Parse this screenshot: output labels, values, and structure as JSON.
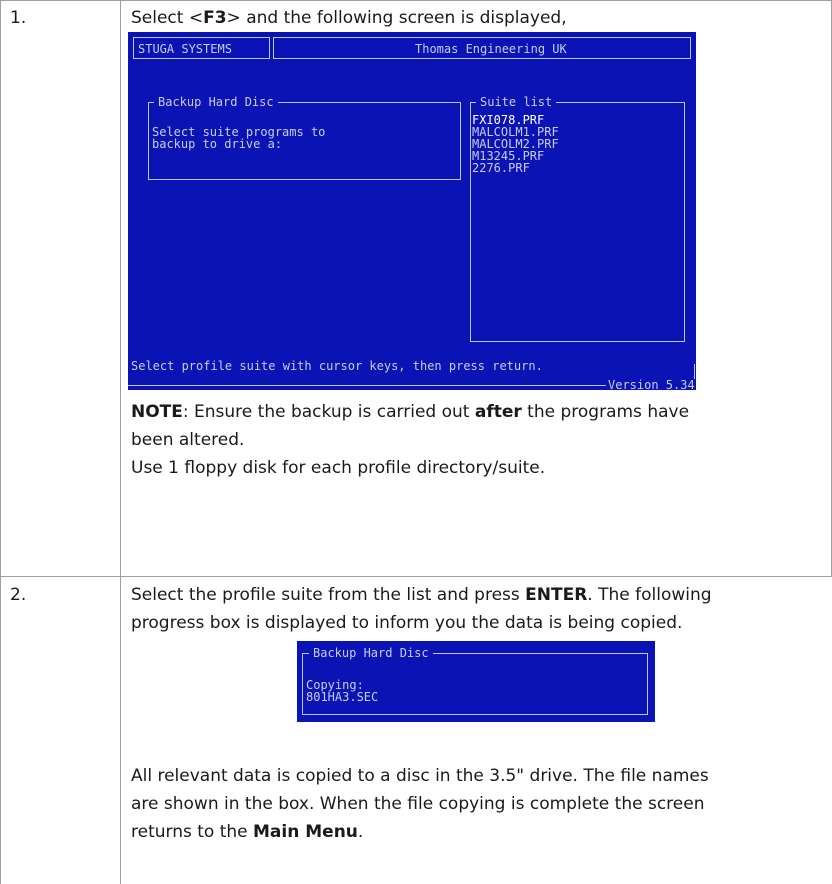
{
  "rows": [
    {
      "number": "1.",
      "intro_prefix": "Select <",
      "intro_key": "F3",
      "intro_suffix": "> and the following screen is displayed,",
      "screen": {
        "company_left": "STUGA SYSTEMS",
        "company_right": "Thomas Engineering UK",
        "panel_title": "Backup Hard Disc",
        "panel_text_1": "Select suite programs to",
        "panel_text_2": "backup to drive a:",
        "list_title": "Suite list",
        "suites": [
          "FXI078.PRF",
          "MALCOLM1.PRF",
          "MALCOLM2.PRF",
          "M13245.PRF",
          "2276.PRF"
        ],
        "status": "Select profile suite with cursor keys, then press return.",
        "version": "Version 5.34"
      },
      "note_label": "NOTE",
      "note_text_1": ": Ensure the backup is carried out ",
      "note_bold": "after",
      "note_text_2": " the programs have",
      "note_text_3": "been altered.",
      "note_line_2": "Use 1 floppy disk for each profile directory/suite."
    },
    {
      "number": "2.",
      "intro_1a": "Select the profile suite from the list and press ",
      "intro_key": "ENTER",
      "intro_1b": ". The following",
      "intro_2": "progress box is displayed to inform you the data is being copied.",
      "box": {
        "title": "Backup Hard Disc",
        "line_1": "Copying:",
        "line_2": "801HA3.SEC"
      },
      "after_1": "All relevant data is copied to a disc in the 3.5\" drive. The file names",
      "after_2": "are shown in the box. When the file copying is complete the screen",
      "after_3a": "returns to the ",
      "after_3_bold": "Main Menu",
      "after_3b": "."
    }
  ],
  "colors": {
    "dos_background": "#0a14b4",
    "dos_text": "#c9cce8",
    "grid": "#9aa0a6"
  }
}
